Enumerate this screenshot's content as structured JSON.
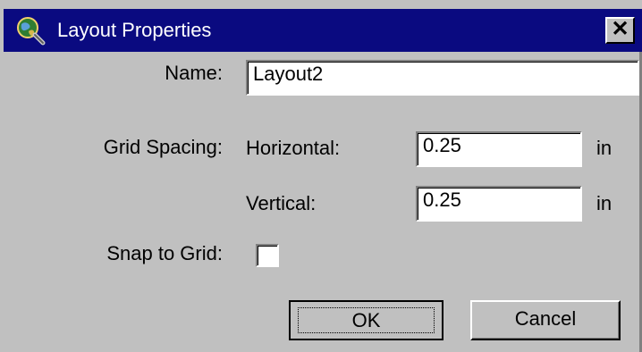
{
  "window": {
    "title": "Layout Properties",
    "title_icon": "globe-magnifier-icon",
    "close_glyph": "✕",
    "colors": {
      "titlebar": "#0a0a80",
      "face": "#c0c0c0"
    }
  },
  "form": {
    "name_label": "Name:",
    "name_value": "Layout2",
    "grid_spacing_label": "Grid Spacing:",
    "horizontal_label": "Horizontal:",
    "horizontal_value": "0.25",
    "horizontal_unit": "in",
    "vertical_label": "Vertical:",
    "vertical_value": "0.25",
    "vertical_unit": "in",
    "snap_label": "Snap to Grid:",
    "snap_checked": false
  },
  "buttons": {
    "ok_label": "OK",
    "cancel_label": "Cancel"
  }
}
